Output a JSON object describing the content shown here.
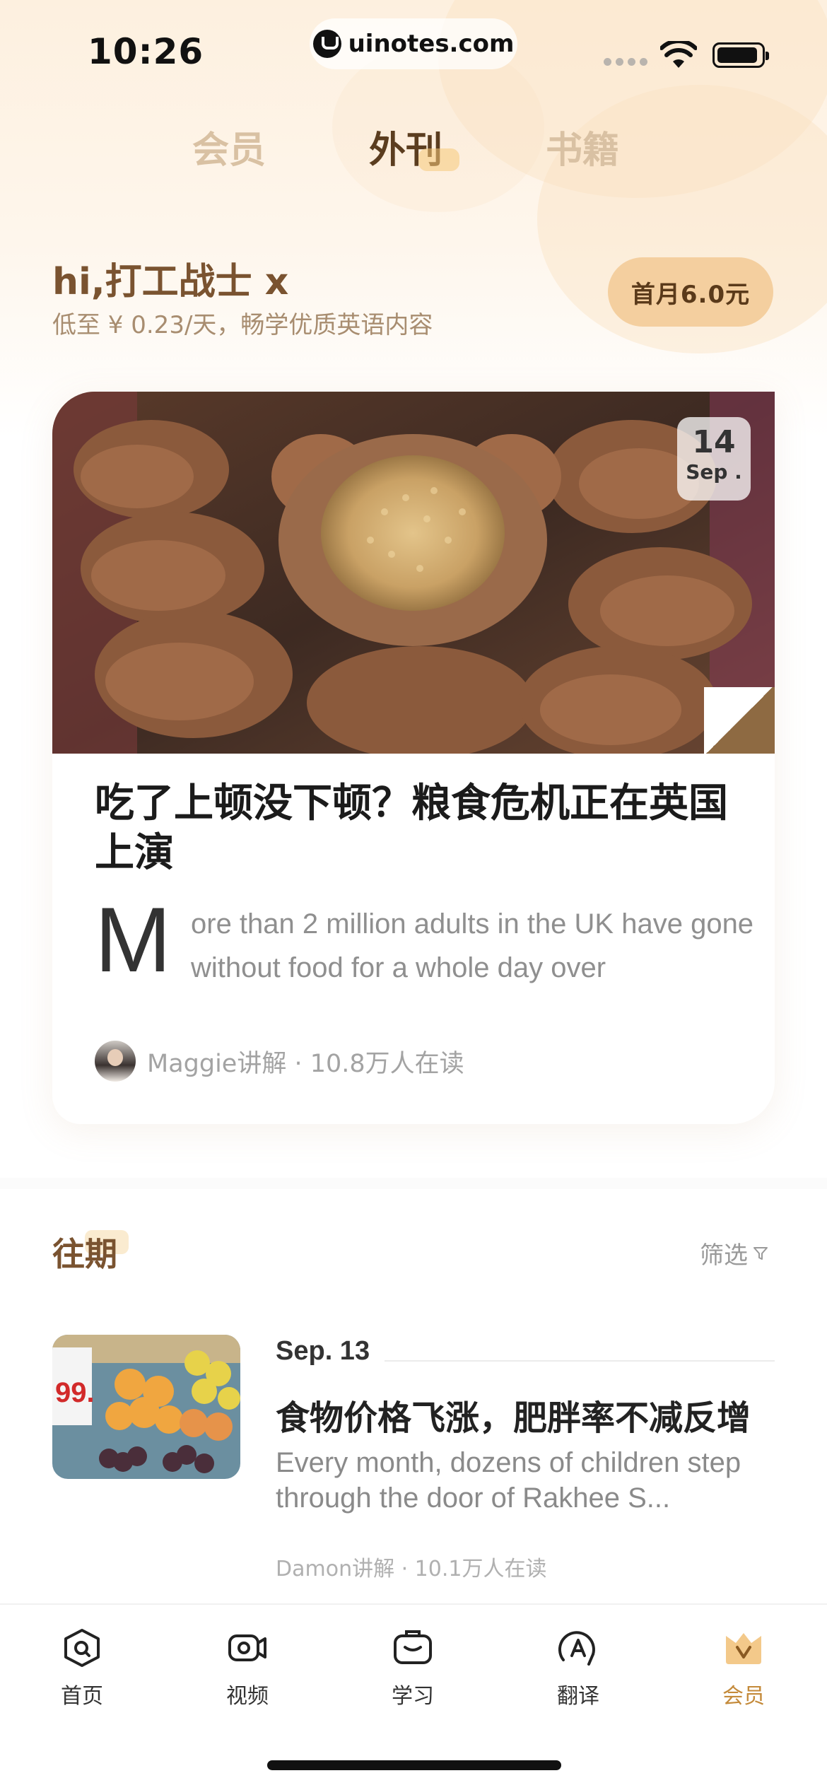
{
  "status_bar": {
    "time": "10:26",
    "url": "uinotes.com"
  },
  "tabs": [
    {
      "label": "会员",
      "active": false
    },
    {
      "label": "外刊",
      "active": true
    },
    {
      "label": "书籍",
      "active": false
    }
  ],
  "greeting": {
    "title": "hi,打工战士 x",
    "subtitle": "低至 ¥ 0.23/天，畅学优质英语内容",
    "price_button": "首月6.0元"
  },
  "featured": {
    "date_day": "14",
    "date_month": "Sep .",
    "title": "吃了上顿没下顿？粮食危机正在英国上演",
    "dropcap": "M",
    "excerpt": "ore than 2 million adults in the UK have gone without food for a whole day over",
    "author": "Maggie讲解 · 10.8万人在读"
  },
  "past": {
    "title": "往期",
    "filter_label": "筛选",
    "items": [
      {
        "date": "Sep. 13",
        "title": "食物价格飞涨，肥胖率不减反增",
        "excerpt": "Every month, dozens of children step through the door of Rakhee S...",
        "meta": "Damon讲解 · 10.1万人在读",
        "image_sign_text": "99."
      }
    ]
  },
  "bottom_nav": [
    {
      "label": "首页",
      "icon": "home-icon",
      "active": false
    },
    {
      "label": "视频",
      "icon": "video-icon",
      "active": false
    },
    {
      "label": "学习",
      "icon": "study-icon",
      "active": false
    },
    {
      "label": "翻译",
      "icon": "translate-icon",
      "active": false
    },
    {
      "label": "会员",
      "icon": "vip-crown-icon",
      "active": true
    }
  ],
  "colors": {
    "accent_brown": "#7a5330",
    "price_button_bg": "#f4cf9f",
    "active_nav": "#c48a3a"
  }
}
